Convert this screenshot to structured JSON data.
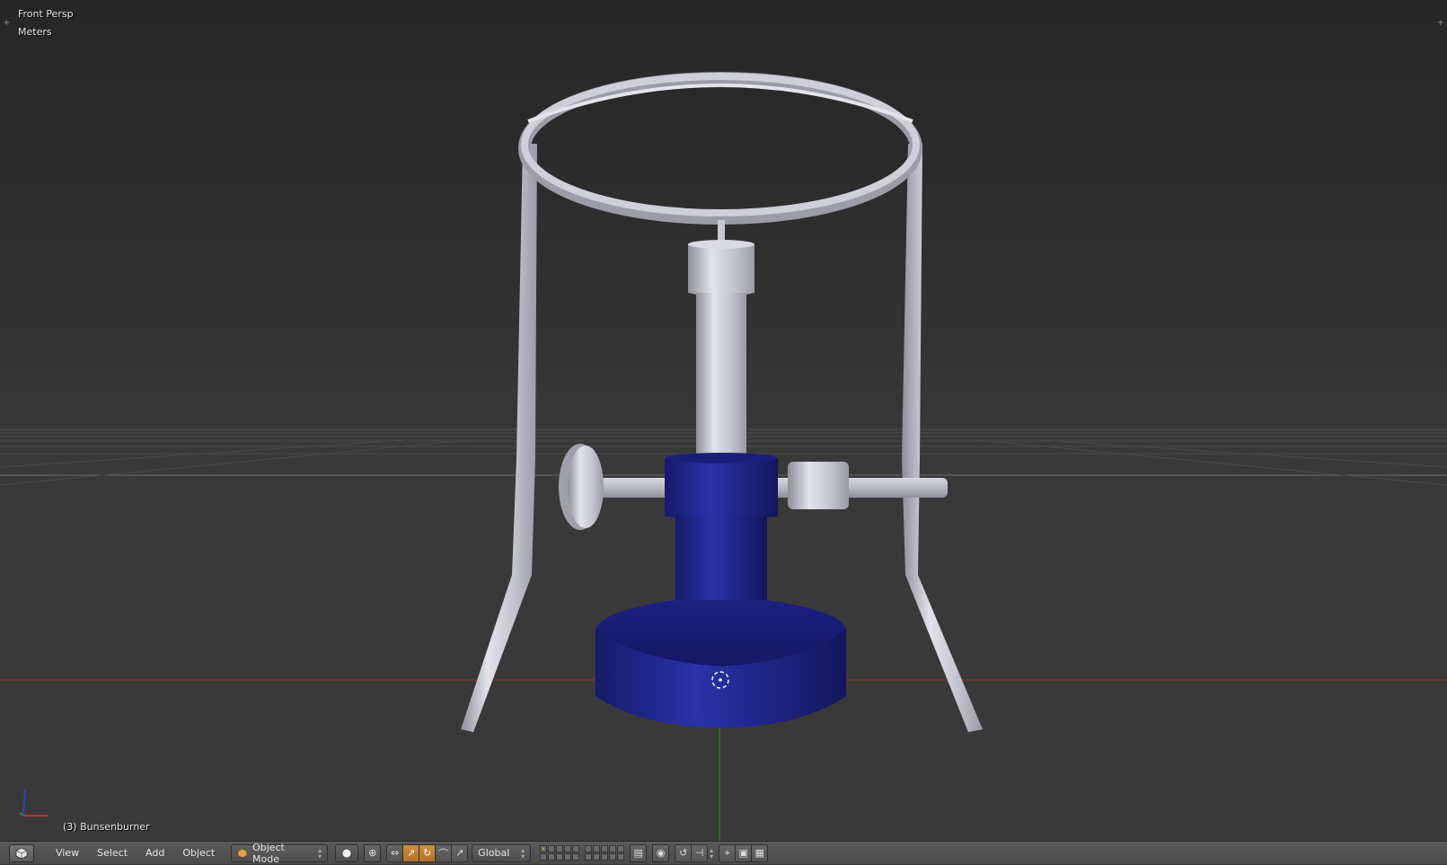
{
  "viewport": {
    "view_name": "Front Persp",
    "unit_system": "Meters",
    "active_object": "(3) Bunsenburner",
    "corner_left": "+",
    "corner_right": "+"
  },
  "header": {
    "editor_icon": "3d-view-icon",
    "menus": [
      "View",
      "Select",
      "Add",
      "Object"
    ],
    "mode": "Object Mode",
    "orientation": "Global"
  },
  "colors": {
    "burner_blue": "#1a1f8a",
    "stand_metal": "#c9c9d6",
    "x_axis": "#c03030",
    "y_axis": "#2a9a2a",
    "active_button": "#c88538"
  }
}
